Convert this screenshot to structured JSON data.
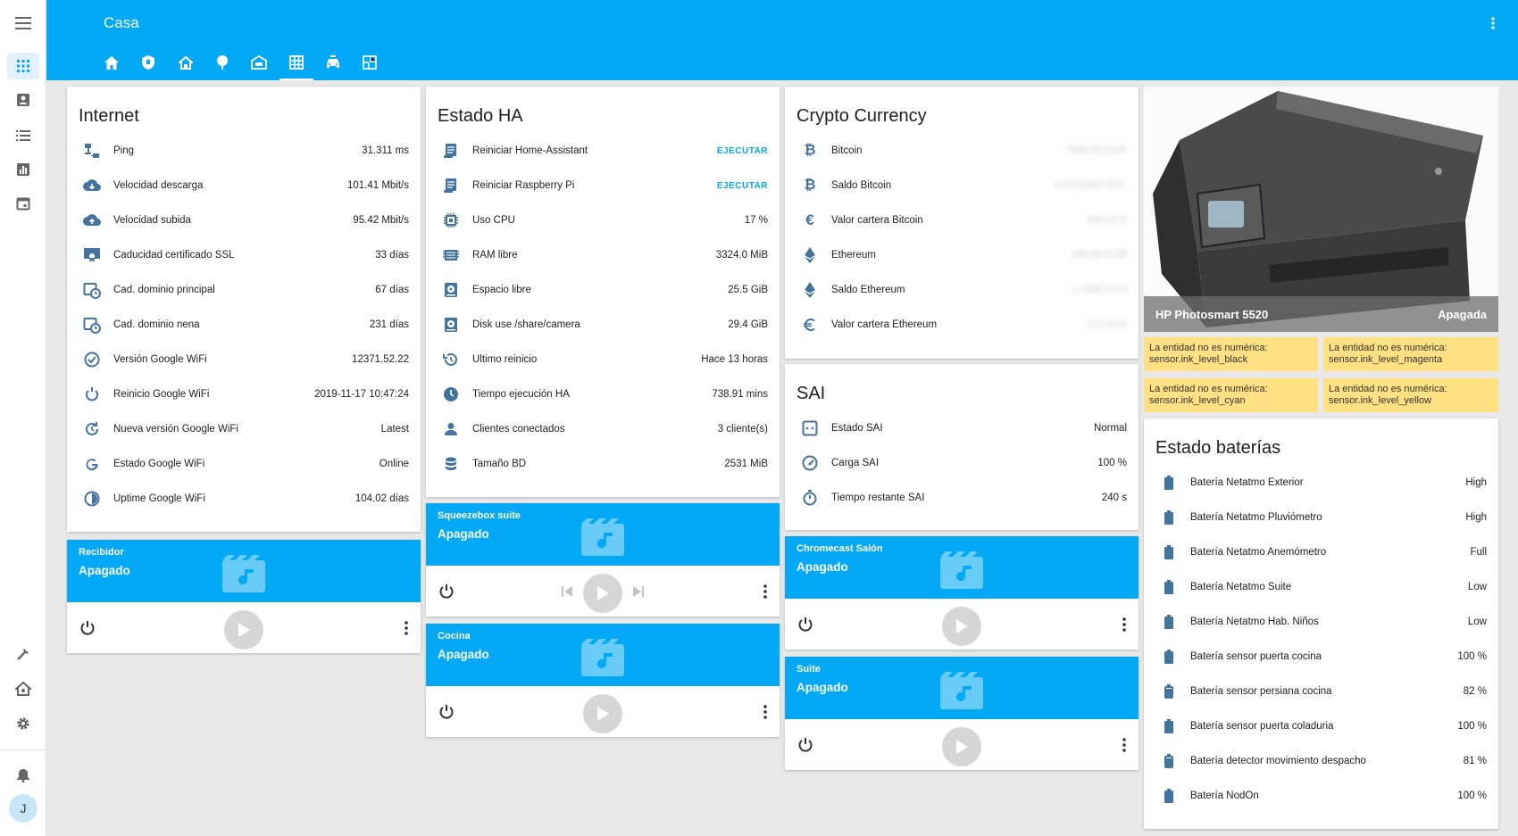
{
  "app": {
    "title": "Casa",
    "user_initial": "J"
  },
  "tabs": [
    {
      "icon": "home-icon"
    },
    {
      "icon": "shield-icon"
    },
    {
      "icon": "house-outline-icon"
    },
    {
      "icon": "tree-icon"
    },
    {
      "icon": "garage-icon"
    },
    {
      "icon": "grid-icon"
    },
    {
      "icon": "car-icon"
    },
    {
      "icon": "floorplan-icon"
    }
  ],
  "internet": {
    "title": "Internet",
    "rows": [
      {
        "name": "Ping",
        "value": "31.311 ms"
      },
      {
        "name": "Velocidad descarga",
        "value": "101.41 Mbit/s"
      },
      {
        "name": "Velocidad subida",
        "value": "95.42 Mbit/s"
      },
      {
        "name": "Caducidad certificado SSL",
        "value": "33 días"
      },
      {
        "name": "Cad. dominio principal",
        "value": "67 días"
      },
      {
        "name": "Cad. dominio nena",
        "value": "231 días"
      },
      {
        "name": "Versión Google WiFi",
        "value": "12371.52.22"
      },
      {
        "name": "Reinicio Google WiFi",
        "value": "2019-11-17 10:47:24"
      },
      {
        "name": "Nueva versión Google WiFi",
        "value": "Latest"
      },
      {
        "name": "Estado Google WiFi",
        "value": "Online"
      },
      {
        "name": "Uptime Google WiFi",
        "value": "104.02 días"
      }
    ]
  },
  "estado_ha": {
    "title": "Estado HA",
    "rows": [
      {
        "name": "Reiniciar Home-Assistant",
        "action": "EJECUTAR"
      },
      {
        "name": "Reiniciar Raspberry Pi",
        "action": "EJECUTAR"
      },
      {
        "name": "Uso CPU",
        "value": "17 %"
      },
      {
        "name": "RAM libre",
        "value": "3324.0 MiB"
      },
      {
        "name": "Espacio libre",
        "value": "25.5 GiB"
      },
      {
        "name": "Disk use /share/camera",
        "value": "29.4 GiB"
      },
      {
        "name": "Último reinicio",
        "value": "Hace 13 horas"
      },
      {
        "name": "Tiempo ejecución HA",
        "value": "738.91 mins"
      },
      {
        "name": "Clientes conectados",
        "value": "3 cliente(s)"
      },
      {
        "name": "Tamaño BD",
        "value": "2531 MiB"
      }
    ]
  },
  "crypto": {
    "title": "Crypto Currency",
    "rows": [
      {
        "name": "Bitcoin",
        "value": "7550.50 EUR"
      },
      {
        "name": "Saldo Bitcoin",
        "value": "0.0123456 BTC"
      },
      {
        "name": "Valor cartera Bitcoin",
        "value": "999.22 €"
      },
      {
        "name": "Ethereum",
        "value": "160.50 EUR"
      },
      {
        "name": "Saldo Ethereum",
        "value": "1.2345 ETH"
      },
      {
        "name": "Valor cartera Ethereum",
        "value": "222.33 €"
      }
    ]
  },
  "sai": {
    "title": "SAI",
    "rows": [
      {
        "name": "Estado SAI",
        "value": "Normal"
      },
      {
        "name": "Carga SAI",
        "value": "100 %"
      },
      {
        "name": "Tiempo restante SAI",
        "value": "240 s"
      }
    ]
  },
  "media_players": {
    "recibidor": {
      "name": "Recibidor",
      "state": "Apagado"
    },
    "squeezebox": {
      "name": "Squeezebox suite",
      "state": "Apagado"
    },
    "cocina": {
      "name": "Cocina",
      "state": "Apagado"
    },
    "chromecast": {
      "name": "Chromecast Salón",
      "state": "Apagado"
    },
    "suite": {
      "name": "Suite",
      "state": "Apagado"
    }
  },
  "printer": {
    "name": "HP Photosmart 5520",
    "state": "Apagada"
  },
  "warnings": [
    {
      "line1": "La entidad no es numérica:",
      "line2": "sensor.ink_level_black"
    },
    {
      "line1": "La entidad no es numérica:",
      "line2": "sensor.ink_level_magenta"
    },
    {
      "line1": "La entidad no es numérica:",
      "line2": "sensor.ink_level_cyan"
    },
    {
      "line1": "La entidad no es numérica:",
      "line2": "sensor.ink_level_yellow"
    }
  ],
  "baterias": {
    "title": "Estado baterías",
    "rows": [
      {
        "name": "Batería Netatmo Exterior",
        "value": "High"
      },
      {
        "name": "Batería Netatmo Pluviómetro",
        "value": "High"
      },
      {
        "name": "Batería Netatmo Anemómetro",
        "value": "Full"
      },
      {
        "name": "Batería Netatmo Suite",
        "value": "Low"
      },
      {
        "name": "Batería Netatmo Hab. Niños",
        "value": "Low"
      },
      {
        "name": "Batería sensor puerta cocina",
        "value": "100 %"
      },
      {
        "name": "Batería sensor persiana cocina",
        "value": "82 %"
      },
      {
        "name": "Batería sensor puerta coladuria",
        "value": "100 %"
      },
      {
        "name": "Batería detector movimiento despacho",
        "value": "81 %"
      },
      {
        "name": "Batería NodOn",
        "value": "100 %"
      }
    ]
  },
  "colors": {
    "accent": "#03a9f4",
    "icon": "#44739e",
    "warning": "#ffe082"
  }
}
